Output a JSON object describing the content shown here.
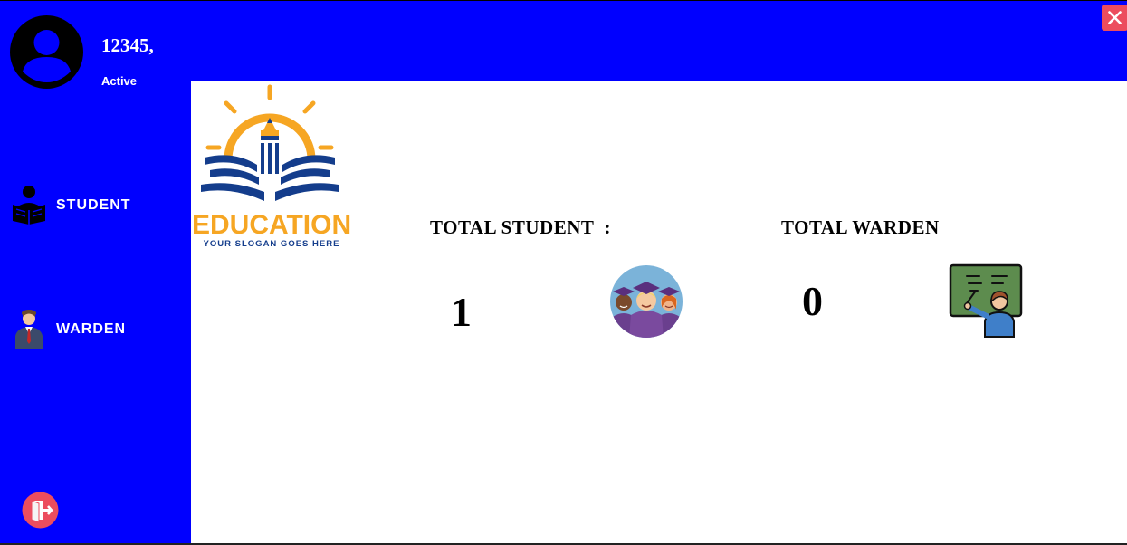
{
  "header": {
    "user_id": "12345,",
    "status": "Active"
  },
  "sidebar": {
    "items": [
      {
        "label": "STUDENT",
        "icon": "student-reading-icon"
      },
      {
        "label": "WARDEN",
        "icon": "warden-person-icon"
      }
    ],
    "logout_icon": "logout-icon"
  },
  "logo": {
    "text": "EDUCATION",
    "slogan": "YOUR SLOGAN GOES HERE"
  },
  "stats": {
    "student": {
      "label": "TOTAL STUDENT  :",
      "value": "1",
      "icon": "graduates-icon"
    },
    "warden": {
      "label": "TOTAL WARDEN",
      "value": "0",
      "icon": "teacher-board-icon"
    }
  },
  "colors": {
    "primary": "#0000ff",
    "close": "#ec4d5e",
    "logo_orange": "#f6a623",
    "logo_blue": "#143d8c"
  }
}
